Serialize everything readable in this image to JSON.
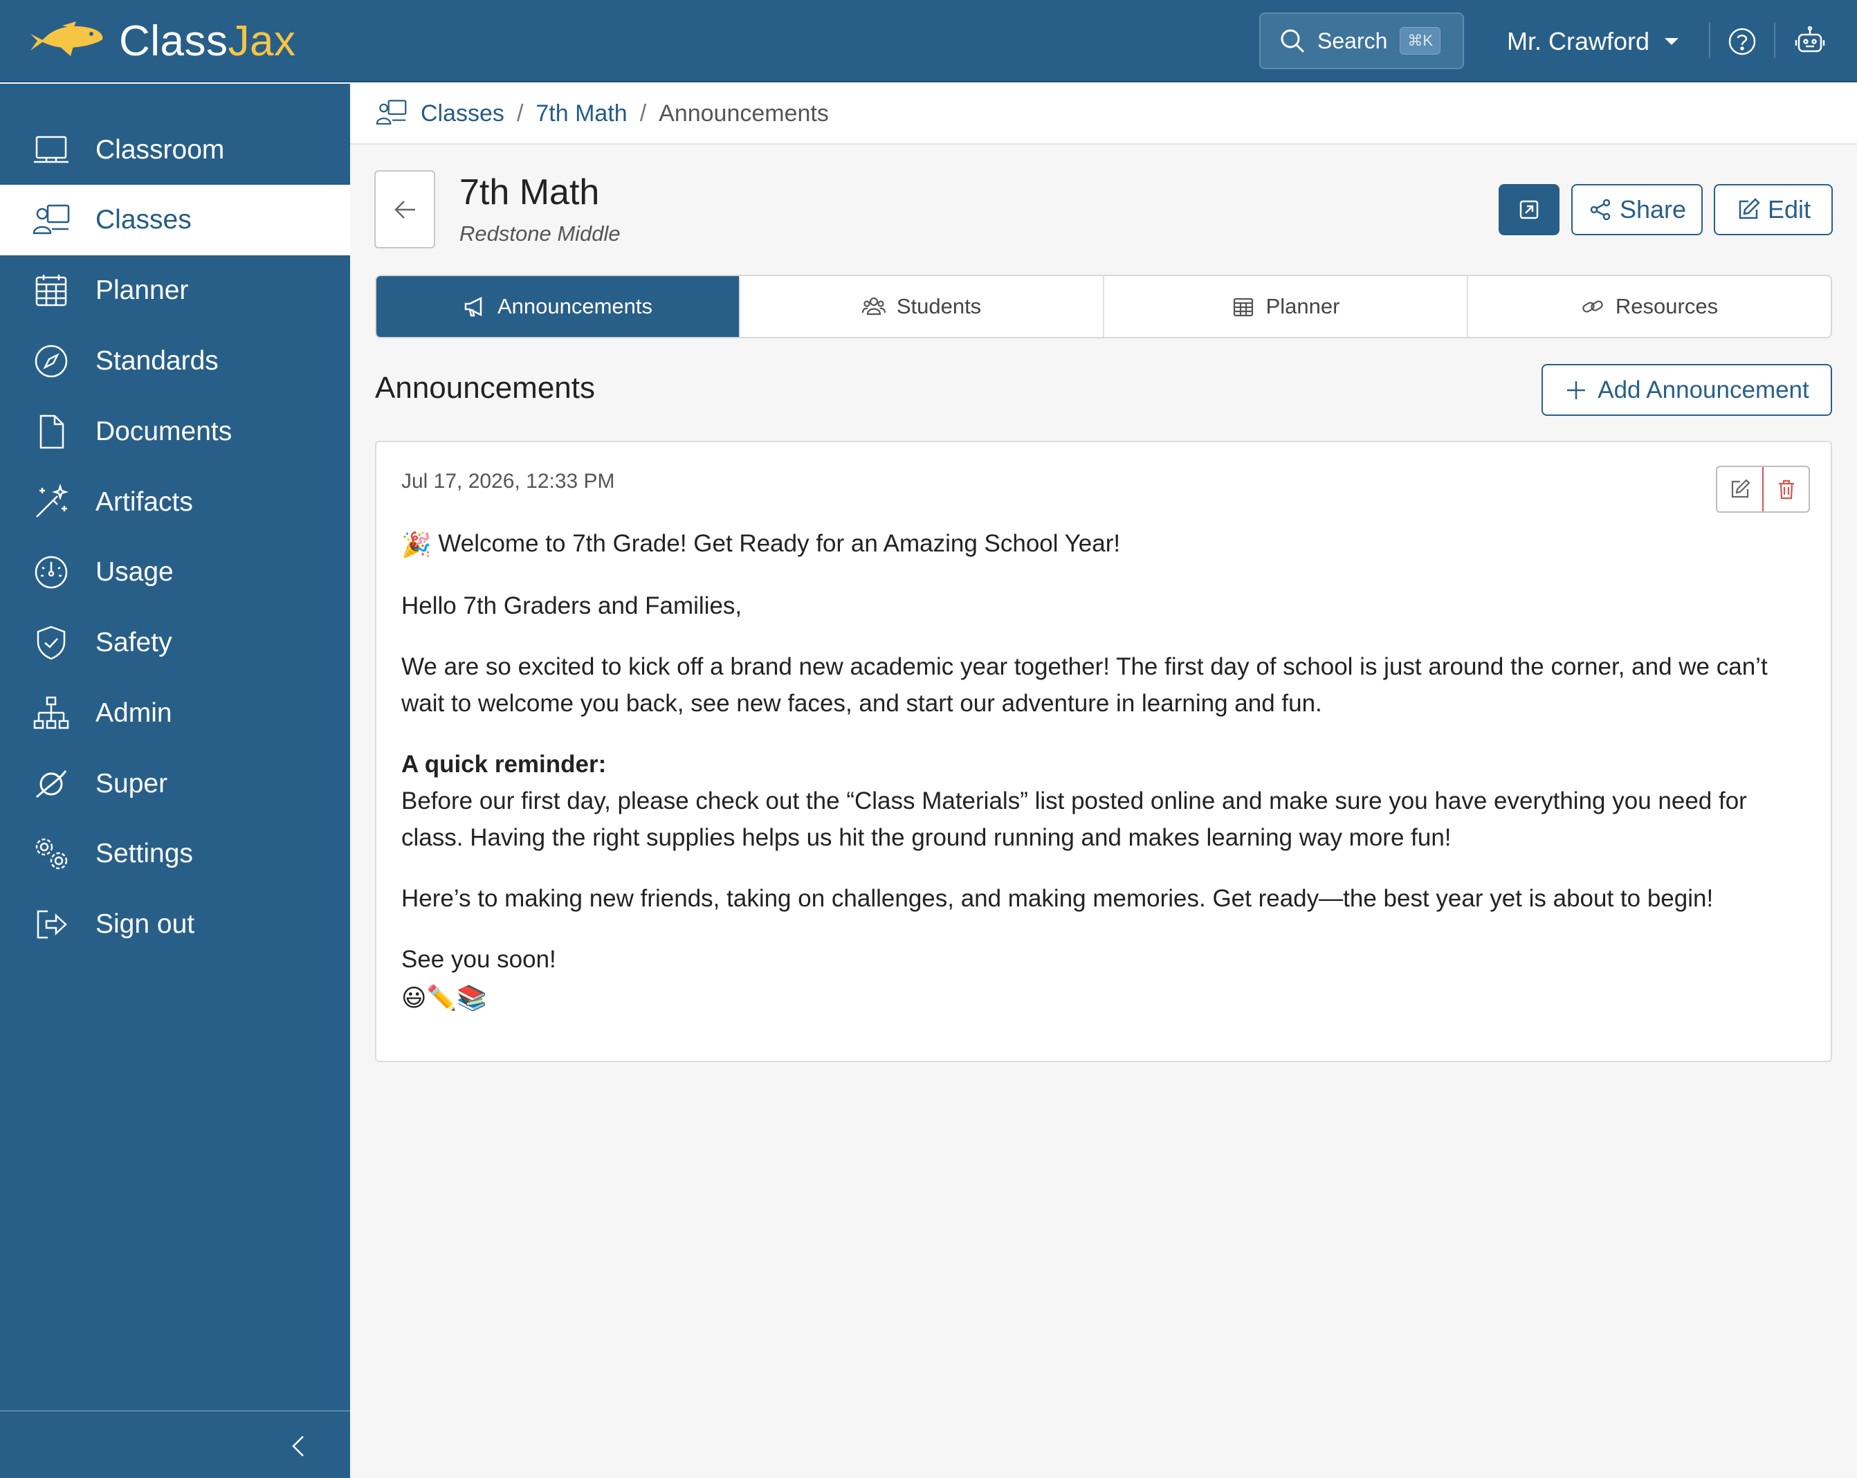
{
  "app": {
    "brand_part1": "Class",
    "brand_part2": "Jax",
    "search_label": "Search",
    "search_shortcut": "⌘K",
    "user_name": "Mr. Crawford"
  },
  "sidebar": {
    "items": [
      {
        "label": "Classroom",
        "icon": "classroom-icon"
      },
      {
        "label": "Classes",
        "icon": "classes-icon",
        "active": true
      },
      {
        "label": "Planner",
        "icon": "calendar-icon"
      },
      {
        "label": "Standards",
        "icon": "compass-icon"
      },
      {
        "label": "Documents",
        "icon": "document-icon"
      },
      {
        "label": "Artifacts",
        "icon": "magic-wand-icon"
      },
      {
        "label": "Usage",
        "icon": "speedometer-icon"
      },
      {
        "label": "Safety",
        "icon": "shield-check-icon"
      },
      {
        "label": "Admin",
        "icon": "org-chart-icon"
      },
      {
        "label": "Super",
        "icon": "orbit-icon"
      },
      {
        "label": "Settings",
        "icon": "gears-icon"
      },
      {
        "label": "Sign out",
        "icon": "sign-out-icon"
      }
    ]
  },
  "breadcrumb": {
    "items": [
      "Classes",
      "7th Math"
    ],
    "current": "Announcements",
    "separator": "/"
  },
  "header": {
    "title": "7th Math",
    "subtitle": "Redstone Middle",
    "share_label": "Share",
    "edit_label": "Edit"
  },
  "tabs": [
    {
      "label": "Announcements",
      "icon": "megaphone-icon",
      "active": true
    },
    {
      "label": "Students",
      "icon": "people-icon"
    },
    {
      "label": "Planner",
      "icon": "calendar-icon"
    },
    {
      "label": "Resources",
      "icon": "link-icon"
    }
  ],
  "section": {
    "title": "Announcements",
    "add_label": "Add Announcement"
  },
  "announcement": {
    "date": "Jul 17, 2026, 12:33 PM",
    "heading_emoji": "🎉",
    "heading": "Welcome to 7th Grade! Get Ready for an Amazing School Year!",
    "greeting": "Hello 7th Graders and Families,",
    "paragraph1": "We are so excited to kick off a brand new academic year together! The first day of school is just around the corner, and we can’t wait to welcome you back, see new faces, and start our adventure in learning and fun.",
    "reminder_title": "A quick reminder:",
    "reminder_text": "Before our first day, please check out the “Class Materials” list posted online and make sure you have everything you need for class. Having the right supplies helps us hit the ground running and makes learning way more fun!",
    "paragraph2": "Here’s to making new friends, taking on challenges, and making memories. Get ready—the best year yet is about to begin!",
    "closing": "See you soon!",
    "closing_emojis": "😃✏️📚"
  },
  "colors": {
    "primary": "#285f88",
    "accent_logo": "#f6c544",
    "danger": "#d9534f",
    "page_bg": "#f6f6f6"
  }
}
